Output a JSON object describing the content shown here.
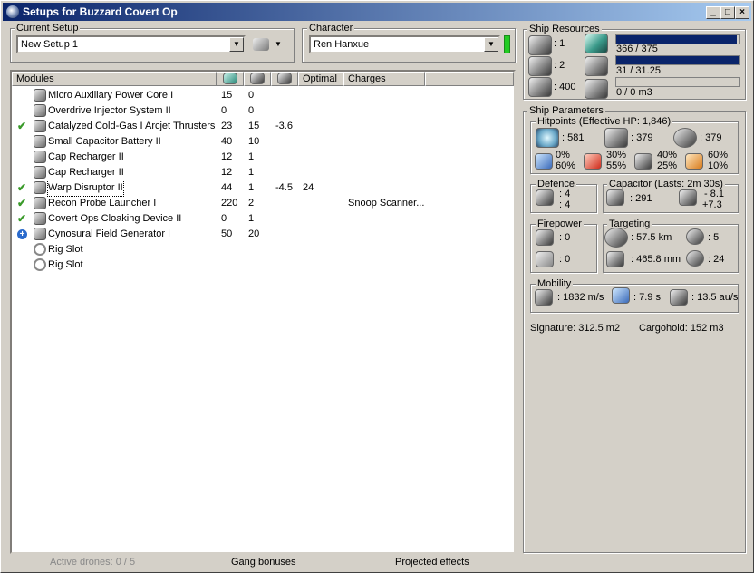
{
  "window": {
    "title": "Setups for Buzzard Covert Op"
  },
  "current_setup": {
    "label": "Current Setup",
    "value": "New Setup 1"
  },
  "character": {
    "label": "Character",
    "value": "Ren Hanxue",
    "status_color": "#22cc22"
  },
  "modules_table": {
    "columns": [
      "Modules",
      "",
      "",
      "",
      "Optimal",
      "Charges"
    ],
    "column_icons": [
      "cpu-icon",
      "powergrid-icon",
      "capacitor-icon"
    ],
    "rows": [
      {
        "check": "",
        "icon": "power-core-icon",
        "name": "Micro Auxiliary Power Core I",
        "cpu": "15",
        "pg": "0",
        "cap": "",
        "optimal": "",
        "charges": ""
      },
      {
        "check": "",
        "icon": "injector-icon",
        "name": "Overdrive Injector System II",
        "cpu": "0",
        "pg": "0",
        "cap": "",
        "optimal": "",
        "charges": ""
      },
      {
        "check": "✔",
        "icon": "thruster-icon",
        "name": "Catalyzed Cold-Gas I Arcjet Thrusters",
        "cpu": "23",
        "pg": "15",
        "cap": "-3.6",
        "optimal": "",
        "charges": ""
      },
      {
        "check": "",
        "icon": "capacitor-battery-icon",
        "name": "Small Capacitor Battery II",
        "cpu": "40",
        "pg": "10",
        "cap": "",
        "optimal": "",
        "charges": ""
      },
      {
        "check": "",
        "icon": "cap-recharger-icon",
        "name": "Cap Recharger II",
        "cpu": "12",
        "pg": "1",
        "cap": "",
        "optimal": "",
        "charges": ""
      },
      {
        "check": "",
        "icon": "cap-recharger-icon",
        "name": "Cap Recharger II",
        "cpu": "12",
        "pg": "1",
        "cap": "",
        "optimal": "",
        "charges": ""
      },
      {
        "check": "✔",
        "icon": "warp-disruptor-icon",
        "name": "Warp Disruptor II",
        "cpu": "44",
        "pg": "1",
        "cap": "-4.5",
        "optimal": "24",
        "charges": ""
      },
      {
        "check": "✔",
        "icon": "probe-launcher-icon",
        "name": "Recon Probe Launcher I",
        "cpu": "220",
        "pg": "2",
        "cap": "",
        "optimal": "",
        "charges": "Snoop Scanner..."
      },
      {
        "check": "✔",
        "icon": "cloak-icon",
        "name": "Covert Ops Cloaking Device II",
        "cpu": "0",
        "pg": "1",
        "cap": "",
        "optimal": "",
        "charges": ""
      },
      {
        "check": "+",
        "icon": "cyno-icon",
        "name": "Cynosural Field Generator I",
        "cpu": "50",
        "pg": "20",
        "cap": "",
        "optimal": "",
        "charges": ""
      },
      {
        "check": "",
        "icon": "rig-slot-icon",
        "name": "Rig Slot",
        "cpu": "",
        "pg": "",
        "cap": "",
        "optimal": "",
        "charges": ""
      },
      {
        "check": "",
        "icon": "rig-slot-icon",
        "name": "Rig Slot",
        "cpu": "",
        "pg": "",
        "cap": "",
        "optimal": "",
        "charges": ""
      }
    ]
  },
  "bottom": {
    "active_drones": "Active drones: 0 / 5",
    "gang_bonuses": "Gang bonuses",
    "projected_effects": "Projected effects"
  },
  "ship_resources": {
    "label": "Ship Resources",
    "slots": [
      ": 1",
      ": 2",
      ": 400"
    ],
    "cpu": {
      "text": "366 / 375",
      "fraction": 0.976
    },
    "powergrid": {
      "text": "31 / 31.25",
      "fraction": 0.992
    },
    "drone_bay": {
      "text": "0 / 0 m3",
      "fraction": 0
    }
  },
  "ship_parameters": {
    "label": "Ship Parameters",
    "hitpoints": {
      "label": "Hitpoints (Effective HP: 1,846)",
      "shield": ": 581",
      "armor": ": 379",
      "structure": ": 379",
      "resists": [
        {
          "top": "0%",
          "bottom": "60%"
        },
        {
          "top": "30%",
          "bottom": "55%"
        },
        {
          "top": "40%",
          "bottom": "25%"
        },
        {
          "top": "60%",
          "bottom": "10%"
        }
      ]
    },
    "defence": {
      "label": "Defence",
      "top": ": 4",
      "bottom": ": 4"
    },
    "capacitor": {
      "label": "Capacitor (Lasts: 2m 30s)",
      "amount": ": 291",
      "delta_top": "- 8.1",
      "delta_bottom": "+7.3"
    },
    "firepower": {
      "label": "Firepower",
      "top": ": 0",
      "bottom": ": 0"
    },
    "targeting": {
      "label": "Targeting",
      "range": ": 57.5 km",
      "targets": ": 5",
      "resolution": ": 465.8 mm",
      "sensor": ": 24"
    },
    "mobility": {
      "label": "Mobility",
      "speed": ": 1832 m/s",
      "align": ": 7.9 s",
      "warp": ": 13.5 au/s"
    },
    "signature": "Signature: 312.5 m2",
    "cargohold": "Cargohold: 152 m3"
  }
}
